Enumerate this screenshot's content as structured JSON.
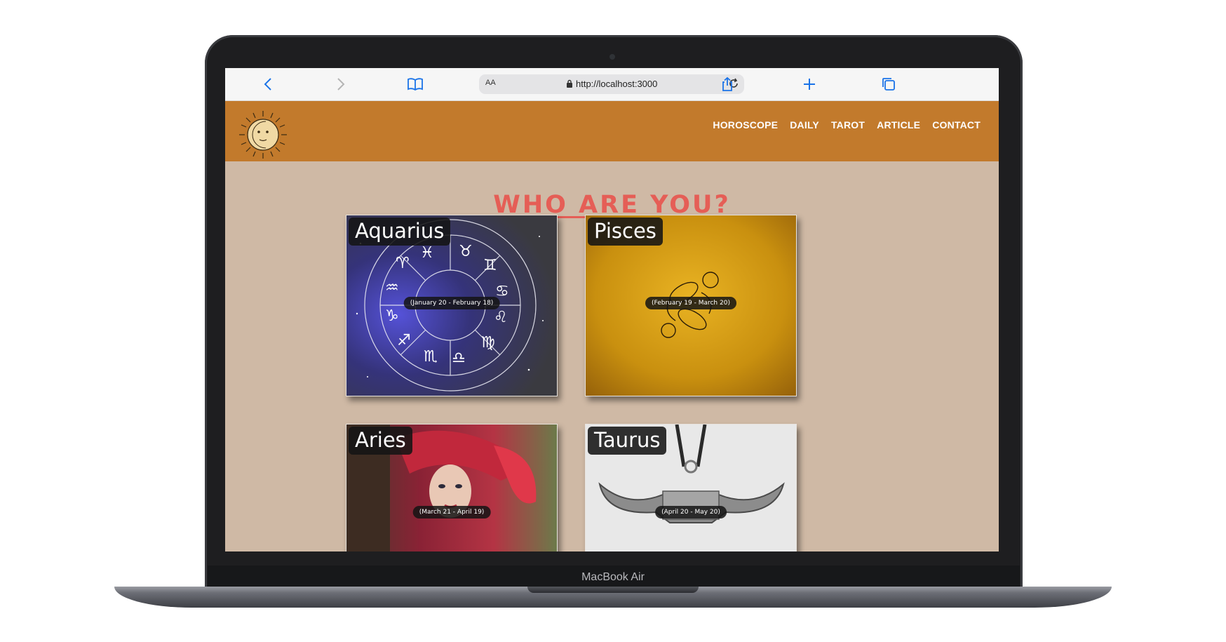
{
  "device": {
    "label": "MacBook Air"
  },
  "browser": {
    "aa_label": "AA",
    "url": "http://localhost:3000"
  },
  "nav": [
    "HOROSCOPE",
    "DAILY",
    "TAROT",
    "ARTICLE",
    "CONTACT"
  ],
  "page_title": "WHO ARE YOU?",
  "signs": [
    {
      "name": "Aquarius",
      "dates": "(January 20 - February 18)"
    },
    {
      "name": "Pisces",
      "dates": "(February 19 - March 20)"
    },
    {
      "name": "Aries",
      "dates": "(March 21 - April 19)"
    },
    {
      "name": "Taurus",
      "dates": "(April 20 - May 20)"
    }
  ],
  "colors": {
    "header": "#c27a2c",
    "page_bg": "#cfb9a5",
    "title": "#e55e56"
  }
}
